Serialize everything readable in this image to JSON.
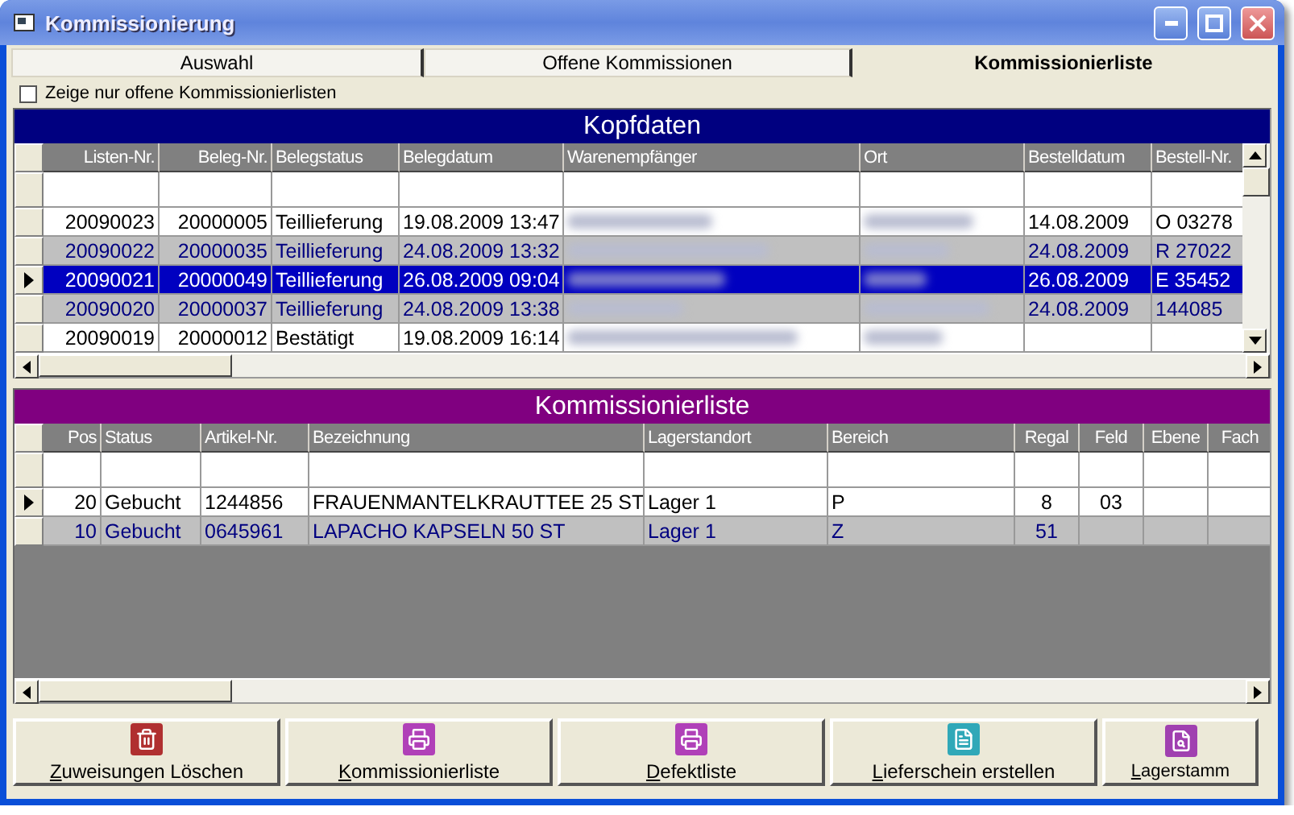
{
  "window": {
    "title": "Kommissionierung"
  },
  "tabs": [
    {
      "label": "Auswahl",
      "selected": false
    },
    {
      "label": "Offene Kommissionen",
      "selected": false
    },
    {
      "label": "Kommissionierliste",
      "selected": true
    }
  ],
  "filter_checkbox": {
    "label": "Zeige nur offene Kommissionierlisten",
    "checked": false
  },
  "header_grid": {
    "title": "Kopfdaten",
    "color": "#000080",
    "columns": [
      "Listen-Nr.",
      "Beleg-Nr.",
      "Belegstatus",
      "Belegdatum",
      "Warenempfänger",
      "Ort",
      "Bestelldatum",
      "Bestell-Nr."
    ],
    "rows": [
      {
        "current": false,
        "selected": false,
        "cells": [
          "20090023",
          "20000005",
          "Teillieferung",
          "19.08.2009 13:47",
          {
            "blurred": true
          },
          {
            "blurred": true
          },
          "14.08.2009",
          "O 03278"
        ]
      },
      {
        "current": false,
        "selected": false,
        "cells": [
          "20090022",
          "20000035",
          "Teillieferung",
          "24.08.2009 13:32",
          {
            "blurred": true
          },
          {
            "blurred": true
          },
          "24.08.2009",
          "R 27022"
        ]
      },
      {
        "current": true,
        "selected": true,
        "cells": [
          "20090021",
          "20000049",
          "Teillieferung",
          "26.08.2009 09:04",
          {
            "blurred": true
          },
          {
            "blurred": true
          },
          "26.08.2009",
          "E 35452"
        ]
      },
      {
        "current": false,
        "selected": false,
        "cells": [
          "20090020",
          "20000037",
          "Teillieferung",
          "24.08.2009 13:38",
          {
            "blurred": true
          },
          {
            "blurred": true
          },
          "24.08.2009",
          "144085"
        ]
      },
      {
        "current": false,
        "selected": false,
        "cells": [
          "20090019",
          "20000012",
          "Bestätigt",
          "19.08.2009 16:14",
          {
            "blurred": true
          },
          {
            "blurred": true
          },
          null,
          null
        ]
      }
    ]
  },
  "detail_grid": {
    "title": "Kommissionierliste",
    "color": "#800080",
    "columns": [
      "Pos",
      "Status",
      "Artikel-Nr.",
      "Bezeichnung",
      "Lagerstandort",
      "Bereich",
      "Regal",
      "Feld",
      "Ebene",
      "Fach"
    ],
    "rows": [
      {
        "current": true,
        "selected": false,
        "cells": [
          "20",
          "Gebucht",
          "1244856",
          "FRAUENMANTELKRAUTTEE 25 ST",
          "Lager 1",
          "P",
          "8",
          "03",
          null,
          null
        ]
      },
      {
        "current": false,
        "selected": false,
        "cells": [
          "10",
          "Gebucht",
          "0645961",
          "LAPACHO KAPSELN 50 ST",
          "Lager 1",
          "Z",
          "51",
          null,
          null,
          null
        ]
      }
    ]
  },
  "buttons": [
    {
      "label": "Zuweisungen Löschen",
      "kind": "delete"
    },
    {
      "label": "Kommissionierliste",
      "kind": "print"
    },
    {
      "label": "Defektliste",
      "kind": "print"
    },
    {
      "label": "Lieferschein erstellen",
      "kind": "document"
    },
    {
      "label": "Lagerstamm",
      "kind": "lookup"
    }
  ]
}
